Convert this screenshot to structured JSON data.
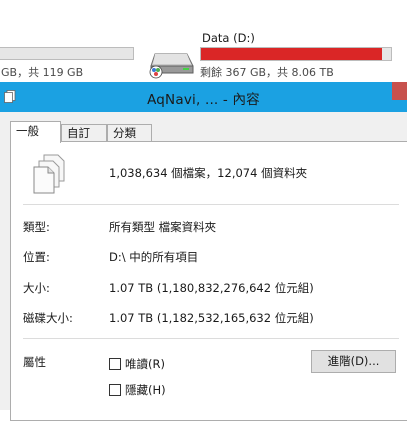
{
  "background": {
    "left_drive_info": "GB，共 119 GB",
    "drive": {
      "name": "Data (D:)",
      "info": "剩餘 367 GB，共 8.06 TB",
      "used_fraction": 0.955,
      "bar_color": "#da2626",
      "icon": "hard-drive-icon"
    }
  },
  "titlebar": {
    "title": "AqNavi, ... - 內容",
    "icon": "properties-icon",
    "color": "#1ba1e2"
  },
  "tabs": [
    {
      "label": "一般",
      "active": true
    },
    {
      "label": "自訂",
      "active": false
    },
    {
      "label": "分類",
      "active": false
    }
  ],
  "general": {
    "summary": "1,038,634 個檔案，12,074 個資料夾",
    "type": {
      "label": "類型:",
      "value": "所有類型 檔案資料夾"
    },
    "location": {
      "label": "位置:",
      "value": "D:\\ 中的所有項目"
    },
    "size": {
      "label": "大小:",
      "value": "1.07 TB (1,180,832,276,642 位元組)"
    },
    "size_on_disk": {
      "label": "磁碟大小:",
      "value": "1.07 TB (1,182,532,165,632 位元組)"
    },
    "attributes": {
      "label": "屬性",
      "readonly": {
        "label": "唯讀(R)",
        "checked": false
      },
      "hidden": {
        "label": "隱藏(H)",
        "checked": false
      },
      "advanced_button": "進階(D)..."
    }
  }
}
